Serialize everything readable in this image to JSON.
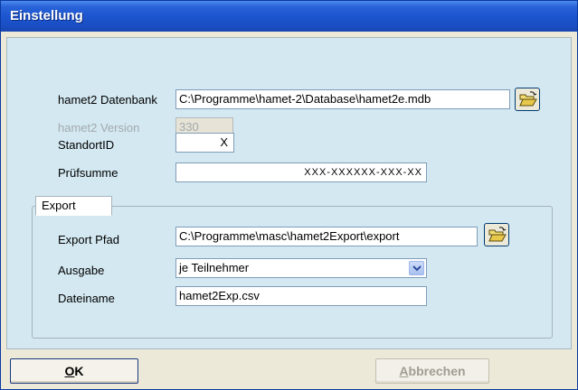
{
  "window": {
    "title": "Einstellung"
  },
  "database": {
    "label": "hamet2 Datenbank",
    "value": "C:\\Programme\\hamet-2\\Database\\hamet2e.mdb",
    "browse_icon": "open-folder-icon"
  },
  "version": {
    "label": "hamet2 Version",
    "value": "330"
  },
  "standort": {
    "label": "StandortID",
    "value": "X"
  },
  "pruefsumme": {
    "label": "Prüfsumme",
    "value": "XXX-XXXXXX-XXX-XX"
  },
  "export": {
    "group_label": "Export",
    "path_label": "Export Pfad",
    "path_value": "C:\\Programme\\masc\\hamet2Export\\export",
    "browse_icon": "open-folder-icon",
    "ausgabe_label": "Ausgabe",
    "ausgabe_value": "je Teilnehmer",
    "dateiname_label": "Dateiname",
    "dateiname_value": "hamet2Exp.csv"
  },
  "buttons": {
    "ok_mnemonic": "O",
    "ok_rest": "K",
    "cancel_mnemonic": "A",
    "cancel_rest": "bbrechen"
  },
  "colors": {
    "title_bar": "#1c55cf",
    "client_bg": "#d3e8f1",
    "folder_yellow": "#e8c84a"
  }
}
